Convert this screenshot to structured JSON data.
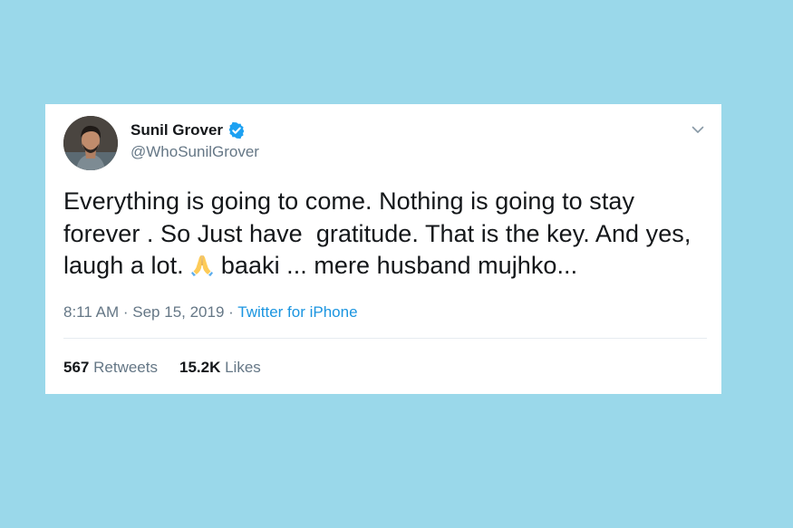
{
  "tweet": {
    "author": {
      "display_name": "Sunil Grover",
      "handle": "@WhoSunilGrover",
      "verified_icon": "verified-badge-icon",
      "avatar": "profile-photo"
    },
    "text_before_emoji": "Everything is going to come. Nothing is going to stay forever . So Just have  gratitude. That is the key. And yes, laugh a lot. ",
    "emoji": "folded-hands-emoji",
    "text_after_emoji": " baaki ... mere husband mujhko...",
    "time": "8:11 AM",
    "separator": "·",
    "date": "Sep 15, 2019",
    "source": "Twitter for iPhone",
    "stats": {
      "retweets_count": "567",
      "retweets_label": "Retweets",
      "likes_count": "15.2K",
      "likes_label": "Likes"
    }
  },
  "colors": {
    "background": "#9ad8ea",
    "card": "#ffffff",
    "text_primary": "#14171a",
    "text_secondary": "#657786",
    "link": "#1b95e0",
    "verified": "#1da1f2"
  }
}
